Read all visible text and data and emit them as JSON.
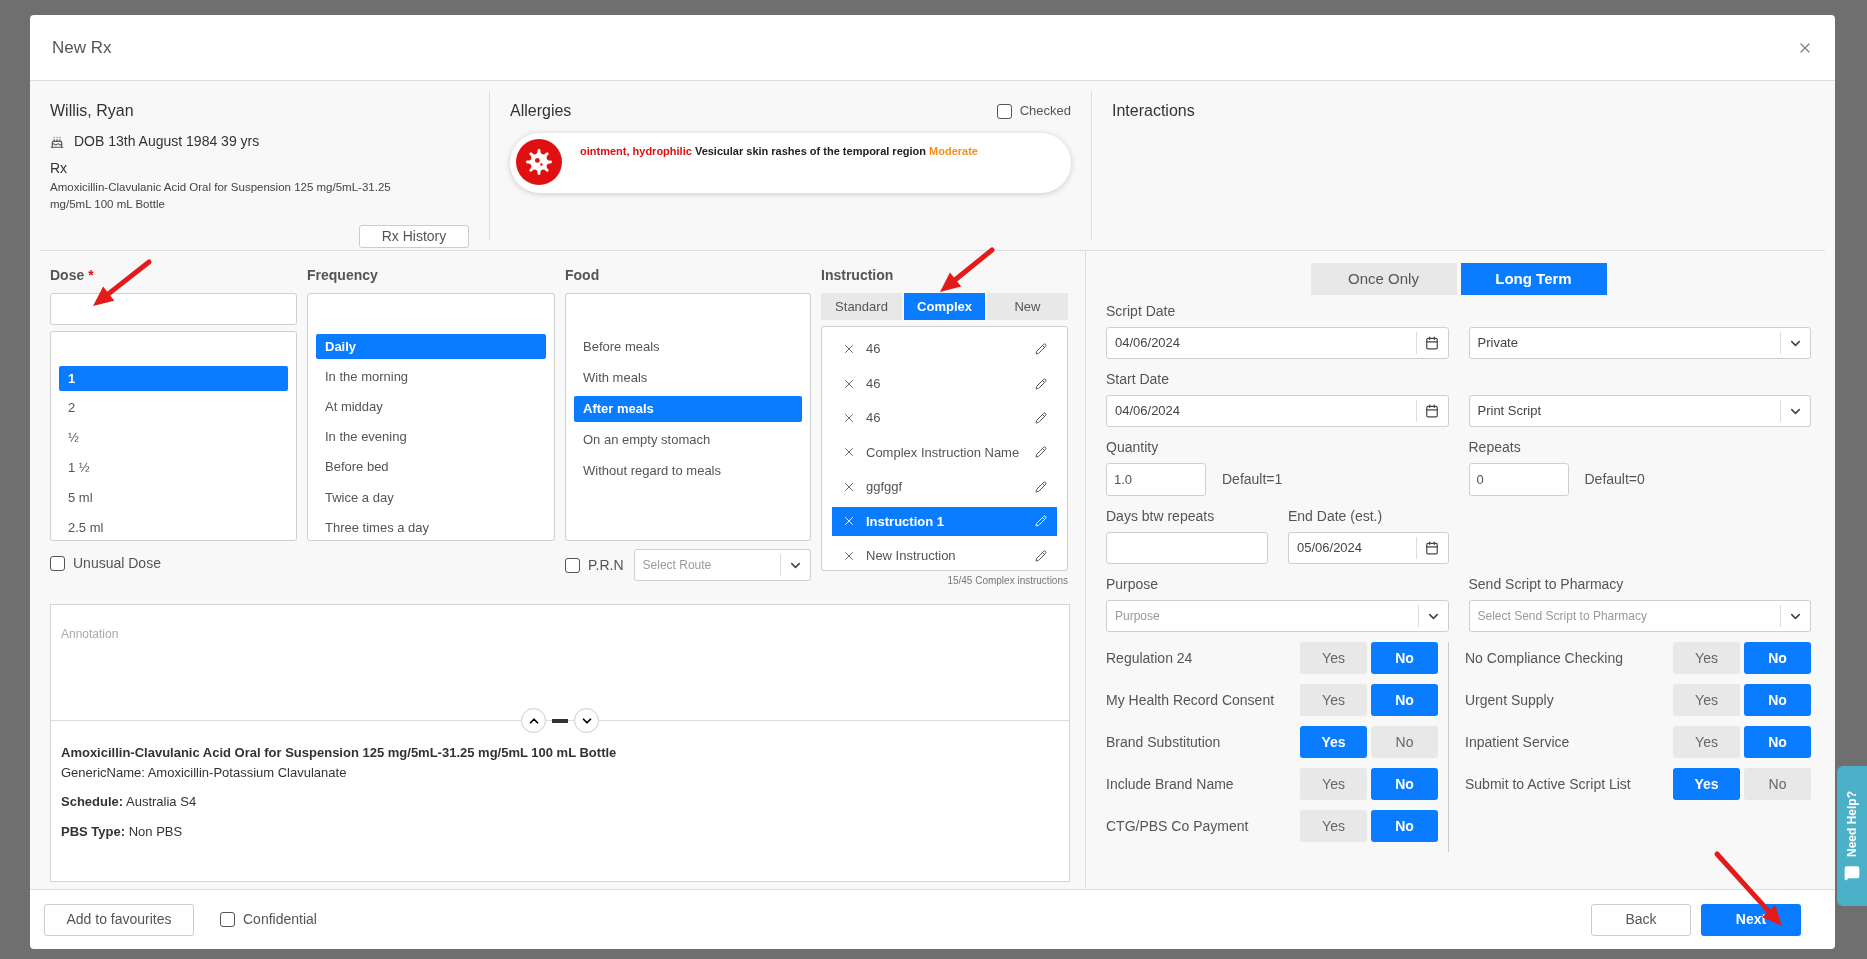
{
  "dialog": {
    "title": "New Rx"
  },
  "patient": {
    "name": "Willis, Ryan",
    "dob": "DOB 13th August 1984 39 yrs",
    "rx_label": "Rx",
    "rx_drug": "Amoxicillin-Clavulanic Acid Oral for Suspension 125 mg/5mL-31.25 mg/5mL 100 mL Bottle",
    "history_button": "Rx History"
  },
  "allergies": {
    "title": "Allergies",
    "checked_label": "Checked",
    "checked": false,
    "items": [
      {
        "substance": "ointment, hydrophilic",
        "reaction": "Vesicular skin rashes of the temporal region",
        "severity": "Moderate"
      }
    ]
  },
  "interactions": {
    "title": "Interactions"
  },
  "dose": {
    "label": "Dose",
    "required_mark": "*",
    "unusual": {
      "label": "Unusual Dose",
      "checked": false
    },
    "options": [
      {
        "label": "1",
        "selected": true
      },
      {
        "label": "2",
        "selected": false
      },
      {
        "label": "½",
        "selected": false
      },
      {
        "label": "1 ½",
        "selected": false
      },
      {
        "label": "5 ml",
        "selected": false
      },
      {
        "label": "2.5 ml",
        "selected": false
      }
    ]
  },
  "frequency": {
    "label": "Frequency",
    "options": [
      {
        "label": "Daily",
        "selected": true
      },
      {
        "label": "In the morning",
        "selected": false
      },
      {
        "label": "At midday",
        "selected": false
      },
      {
        "label": "In the evening",
        "selected": false
      },
      {
        "label": "Before bed",
        "selected": false
      },
      {
        "label": "Twice a day",
        "selected": false
      },
      {
        "label": "Three times a day",
        "selected": false
      }
    ]
  },
  "food": {
    "label": "Food",
    "prn": {
      "label": "P.R.N",
      "checked": false
    },
    "route": {
      "placeholder": "Select Route"
    },
    "options": [
      {
        "label": "Before meals",
        "selected": false
      },
      {
        "label": "With meals",
        "selected": false
      },
      {
        "label": "After meals",
        "selected": true
      },
      {
        "label": "On an empty stomach",
        "selected": false
      },
      {
        "label": "Without regard to meals",
        "selected": false
      }
    ]
  },
  "instruction": {
    "label": "Instruction",
    "count": "15/45 Complex instructions",
    "tabs": [
      {
        "label": "Standard",
        "selected": false
      },
      {
        "label": "Complex",
        "selected": true
      },
      {
        "label": "New",
        "selected": false
      }
    ],
    "items": [
      {
        "label": "46",
        "selected": false
      },
      {
        "label": "46",
        "selected": false
      },
      {
        "label": "46",
        "selected": false
      },
      {
        "label": "Complex Instruction Name",
        "selected": false
      },
      {
        "label": "ggfggf",
        "selected": false
      },
      {
        "label": "Instruction 1",
        "selected": true
      },
      {
        "label": "New Instruction",
        "selected": false
      }
    ]
  },
  "annotation": {
    "placeholder": "Annotation"
  },
  "drug_info": {
    "name": "Amoxicillin-Clavulanic Acid Oral for Suspension 125 mg/5mL-31.25 mg/5mL 100 mL Bottle",
    "generic": "GenericName: Amoxicillin-Potassium Clavulanate",
    "schedule": "**Schedule:** Australia S4",
    "pbs": "**PBS Type:** Non PBS"
  },
  "term_tabs": [
    {
      "label": "Once Only",
      "selected": false
    },
    {
      "label": "Long Term",
      "selected": true
    }
  ],
  "script_date": {
    "label": "Script Date",
    "value": "04/06/2024"
  },
  "funding": {
    "value": "Private"
  },
  "start_date": {
    "label": "Start Date",
    "value": "04/06/2024"
  },
  "script_type": {
    "value": "Print Script"
  },
  "quantity": {
    "label": "Quantity",
    "value": "1.0",
    "default": "Default=1"
  },
  "repeats": {
    "label": "Repeats",
    "value": "0",
    "default": "Default=0"
  },
  "days_between": {
    "label": "Days btw repeats"
  },
  "end_date": {
    "label": "End Date (est.)",
    "value": "05/06/2024"
  },
  "purpose": {
    "label": "Purpose",
    "placeholder": "Purpose"
  },
  "pharmacy": {
    "label": "Send Script to Pharmacy",
    "placeholder": "Select Send Script to Pharmacy"
  },
  "toggles_left": [
    {
      "label": "Regulation 24",
      "options": [
        {
          "label": "Yes",
          "selected": false
        },
        {
          "label": "No",
          "selected": true
        }
      ]
    },
    {
      "label": "My Health Record Consent",
      "options": [
        {
          "label": "Yes",
          "selected": false
        },
        {
          "label": "No",
          "selected": true
        }
      ]
    },
    {
      "label": "Brand Substitution",
      "options": [
        {
          "label": "Yes",
          "selected": true
        },
        {
          "label": "No",
          "selected": false
        }
      ]
    },
    {
      "label": "Include Brand Name",
      "options": [
        {
          "label": "Yes",
          "selected": false
        },
        {
          "label": "No",
          "selected": true
        }
      ]
    },
    {
      "label": "CTG/PBS Co Payment",
      "options": [
        {
          "label": "Yes",
          "selected": false
        },
        {
          "label": "No",
          "selected": true
        }
      ]
    }
  ],
  "toggles_right": [
    {
      "label": "No Compliance Checking",
      "options": [
        {
          "label": "Yes",
          "selected": false
        },
        {
          "label": "No",
          "selected": true
        }
      ]
    },
    {
      "label": "Urgent Supply",
      "options": [
        {
          "label": "Yes",
          "selected": false
        },
        {
          "label": "No",
          "selected": true
        }
      ]
    },
    {
      "label": "Inpatient Service",
      "options": [
        {
          "label": "Yes",
          "selected": false
        },
        {
          "label": "No",
          "selected": true
        }
      ]
    },
    {
      "label": "Submit to Active Script List",
      "options": [
        {
          "label": "Yes",
          "selected": true
        },
        {
          "label": "No",
          "selected": false
        }
      ]
    }
  ],
  "footer": {
    "favourites_button": "Add to favourites",
    "confidential": {
      "label": "Confidential",
      "checked": false
    },
    "back_button": "Back",
    "next_button": "Next"
  },
  "help_tab": {
    "label": "Need Help?"
  }
}
